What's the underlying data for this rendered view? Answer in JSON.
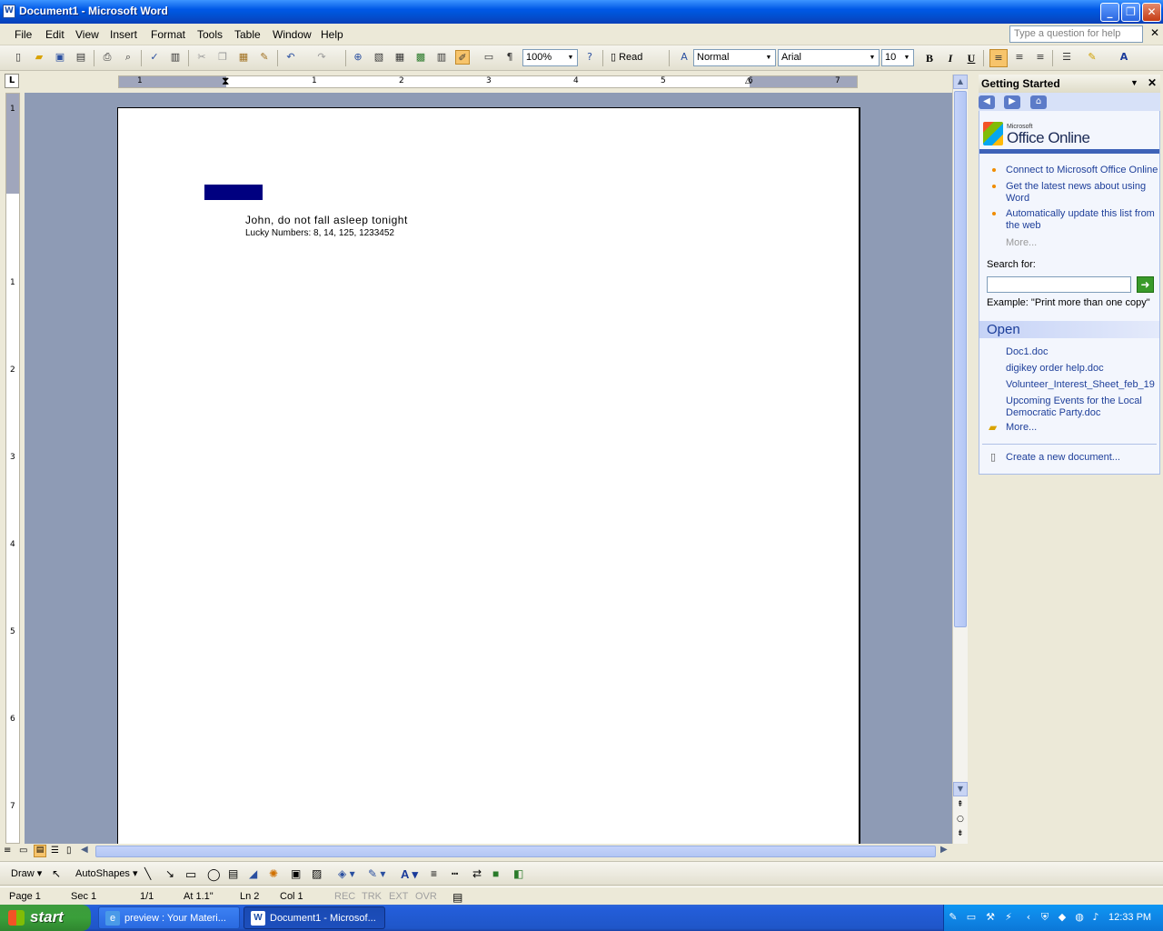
{
  "window": {
    "title": "Document1 - Microsoft Word",
    "min": "_",
    "max": "❐",
    "close": "✕"
  },
  "menu": {
    "items": [
      "File",
      "Edit",
      "View",
      "Insert",
      "Format",
      "Tools",
      "Table",
      "Window",
      "Help"
    ],
    "help_placeholder": "Type a question for help",
    "close": "✕"
  },
  "toolbar": {
    "zoom": "100%",
    "read_label": "Read",
    "style": "Normal",
    "font": "Arial",
    "size": "10",
    "bold": "B",
    "italic": "I",
    "underline": "U"
  },
  "ruler": {
    "h_numbers": [
      "1",
      "1",
      "2",
      "3",
      "4",
      "5",
      "6",
      "7"
    ],
    "v_numbers": [
      "1",
      "1",
      "2",
      "3",
      "4",
      "5",
      "6",
      "7"
    ]
  },
  "document": {
    "line1": "John, do not fall asleep tonight",
    "line2": "Lucky Numbers: 8, 14, 125, 1233452",
    "highlight_color": "#000080"
  },
  "taskpane": {
    "title": "Getting Started",
    "office_microsoft": "Microsoft",
    "office_online": "Office Online",
    "links": [
      "Connect to Microsoft Office Online",
      "Get the latest news about using Word",
      "Automatically update this list from the web"
    ],
    "more": "More...",
    "search_label": "Search for:",
    "example": "Example:  \"Print more than one copy\"",
    "open_header": "Open",
    "open_files": [
      "Doc1.doc",
      "digikey order help.doc",
      "Volunteer_Interest_Sheet_feb_19",
      "Upcoming Events for the Local Democratic Party.doc"
    ],
    "open_more": "More...",
    "create_new": "Create a new document..."
  },
  "drawbar": {
    "draw": "Draw",
    "autoshapes": "AutoShapes"
  },
  "status": {
    "page": "Page 1",
    "sec": "Sec 1",
    "pages": "1/1",
    "at": "At 1.1\"",
    "ln": "Ln 2",
    "col": "Col 1",
    "rec": "REC",
    "trk": "TRK",
    "ext": "EXT",
    "ovr": "OVR"
  },
  "taskbar": {
    "start": "start",
    "task1": "preview : Your Materi...",
    "task2": "Document1 - Microsof...",
    "clock": "12:33 PM"
  }
}
